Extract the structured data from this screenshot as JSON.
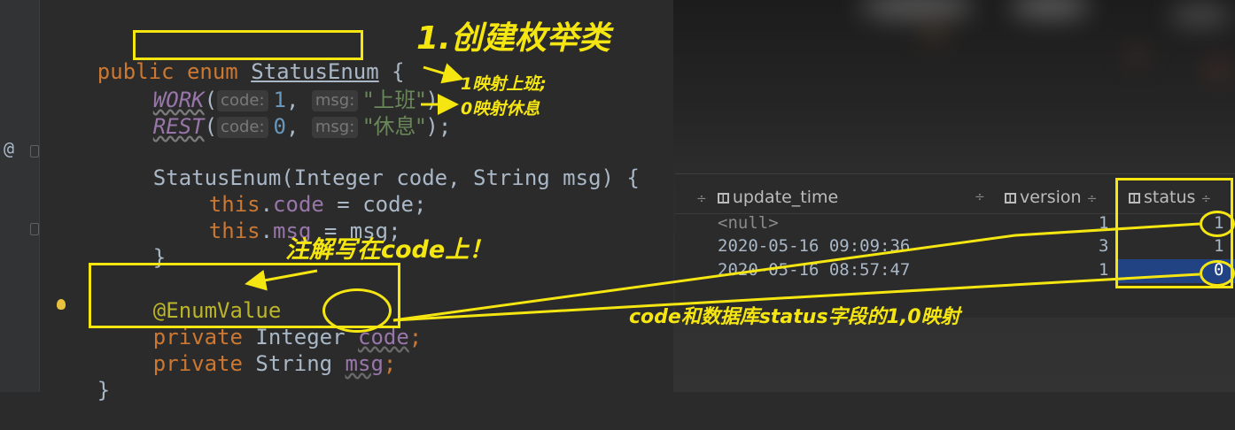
{
  "code": {
    "l1_kw": "public",
    "l1_kw2": "enum",
    "l1_name": "StatusEnum",
    "l1_brace": " {",
    "work_name": "WORK",
    "rest_name": "REST",
    "hint_code": "code:",
    "hint_msg": "msg:",
    "work_code": "1",
    "work_msg": "\"上班\"",
    "rest_code": "0",
    "rest_msg": "\"休息\"",
    "ctor": "StatusEnum(Integer code, String msg) {",
    "this_kw": "this",
    "assign_code_field": "code",
    "assign_code_rest": " = code;",
    "assign_msg_field": "msg",
    "assign_msg_rest": " = msg;",
    "close_inner": "}",
    "annotation": "@EnumValue",
    "private_kw": "private",
    "int_decl": " Integer ",
    "code_field": "code",
    "str_decl": " String ",
    "msg_field": "msg",
    "close_outer": "}",
    "gutter_at": "@"
  },
  "annotations": {
    "create_enum": "1.创建枚举类",
    "map_work": "1映射上班;",
    "map_rest": "0映射休息",
    "note_code": "注解写在code上！",
    "note_mapping": "code和数据库status字段的1,0映射"
  },
  "db_table": {
    "columns": [
      "update_time",
      "version",
      "status"
    ],
    "rows": [
      {
        "update_time": "<null>",
        "version": "1",
        "status": "1"
      },
      {
        "update_time": "2020-05-16 09:09:36",
        "version": "3",
        "status": "1"
      },
      {
        "update_time": "2020-05-16 08:57:47",
        "version": "1",
        "status": "0"
      }
    ]
  },
  "colors": {
    "highlight": "#f5e611",
    "editor_bg": "#2b2b2b",
    "keyword": "#cc7832",
    "field": "#9876aa",
    "string": "#6a8759",
    "number": "#6897bb",
    "annotation": "#bbb529",
    "selected_cell": "#214283"
  }
}
